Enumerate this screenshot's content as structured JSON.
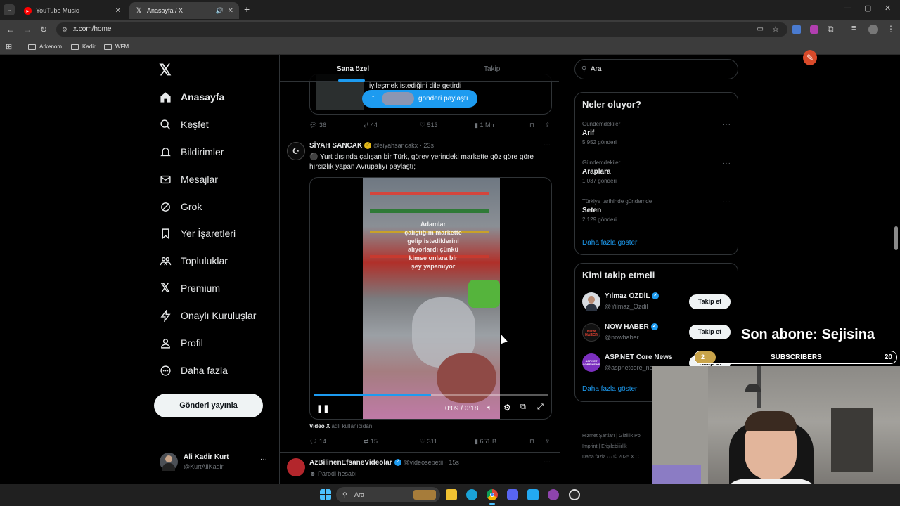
{
  "browser": {
    "tabs": [
      {
        "title": "YouTube Music"
      },
      {
        "title": "Anasayfa / X"
      }
    ],
    "url": "x.com/home",
    "bookmarks": [
      "Arkenom",
      "Kadir",
      "WFM"
    ]
  },
  "sidebar": {
    "items": [
      {
        "label": "Anasayfa",
        "icon": "home-icon"
      },
      {
        "label": "Keşfet",
        "icon": "search-icon"
      },
      {
        "label": "Bildirimler",
        "icon": "bell-icon"
      },
      {
        "label": "Mesajlar",
        "icon": "mail-icon"
      },
      {
        "label": "Grok",
        "icon": "grok-icon"
      },
      {
        "label": "Yer İşaretleri",
        "icon": "bookmark-icon"
      },
      {
        "label": "Topluluklar",
        "icon": "communities-icon"
      },
      {
        "label": "Premium",
        "icon": "x-logo-icon"
      },
      {
        "label": "Onaylı Kuruluşlar",
        "icon": "lightning-icon"
      },
      {
        "label": "Profil",
        "icon": "person-icon"
      },
      {
        "label": "Daha fazla",
        "icon": "more-circle-icon"
      }
    ],
    "post_button": "Gönderi yayınla",
    "account": {
      "name": "Ali Kadir Kurt",
      "handle": "@KurtAliKadir"
    }
  },
  "timeline": {
    "tabs": [
      "Sana özel",
      "Takip"
    ],
    "prev_tweet": {
      "snippet": "iyileşmek istediğini dile getirdi",
      "share_pill": "gönderi paylaştı",
      "stats": {
        "replies": "36",
        "retweets": "44",
        "likes": "513",
        "views": "1 Mn"
      }
    },
    "tweet": {
      "name": "SİYAH SANCAK",
      "handle": "@siyahsancakx",
      "time": "· 23s",
      "text_line1": "⚫ Yurt dışında çalışan bir Türk, görev yerindeki markette göz göre göre",
      "text_line2": "hırsızlık yapan Avrupalıyı paylaştı;",
      "video": {
        "overlay_text": [
          "Adamlar",
          "çalıştığım markette",
          "gelip istediklerini",
          "alıyorlardı çünkü",
          "kimse onlara bir",
          "şey yapamıyor"
        ],
        "time": "0:09 / 0:18",
        "progress": 0.5
      },
      "source_user": "Video X",
      "source_suffix": "adlı kullanıcıdan",
      "stats": {
        "replies": "14",
        "retweets": "15",
        "likes": "311",
        "views": "651 B"
      }
    },
    "next_tweet": {
      "name": "AzBilinenEfsaneVideolar",
      "handle": "@videosepetii",
      "time": "· 15s",
      "tag": "Parodi hesabı"
    }
  },
  "right": {
    "search_placeholder": "Ara",
    "trends_title": "Neler oluyor?",
    "trends": [
      {
        "context": "Gündemdekiler",
        "name": "Arif",
        "count": "5.952 gönderi"
      },
      {
        "context": "Gündemdekiler",
        "name": "Araplara",
        "count": "1.037 gönderi"
      },
      {
        "context": "Türkiye tarihinde gündemde",
        "name": "Seten",
        "count": "2.129 gönderi"
      }
    ],
    "trends_more": "Daha fazla göster",
    "follow_title": "Kimi takip etmeli",
    "follows": [
      {
        "name": "Yılmaz ÖZDİL",
        "handle": "@Yilmaz_Ozdil",
        "button": "Takip et"
      },
      {
        "name": "NOW HABER",
        "handle": "@nowhaber",
        "button": "Takip et",
        "avatar_text": "NOW HABER"
      },
      {
        "name": "ASP.NET Core News",
        "handle": "@aspnetcore_news",
        "button": "Takip et",
        "avatar_text": "ASP.NET CORE NEWS"
      }
    ],
    "follow_more": "Daha fazla göster",
    "footer": [
      "Hizmet Şartları",
      "Gizlilik Po",
      "Imprint",
      "Erişilebilirlik",
      "Daha fazla ···",
      "© 2025 X C"
    ]
  },
  "stream_overlay": {
    "last_sub": "Son abone: Sejisina",
    "subs_label": "SUBSCRIBERS",
    "subs_count": "20",
    "badge": "2"
  },
  "taskbar": {
    "search_placeholder": "Ara"
  },
  "colors": {
    "accent": "#1d9bf0",
    "bg": "#000000",
    "text": "#e7e9ea",
    "muted": "#71767b"
  }
}
